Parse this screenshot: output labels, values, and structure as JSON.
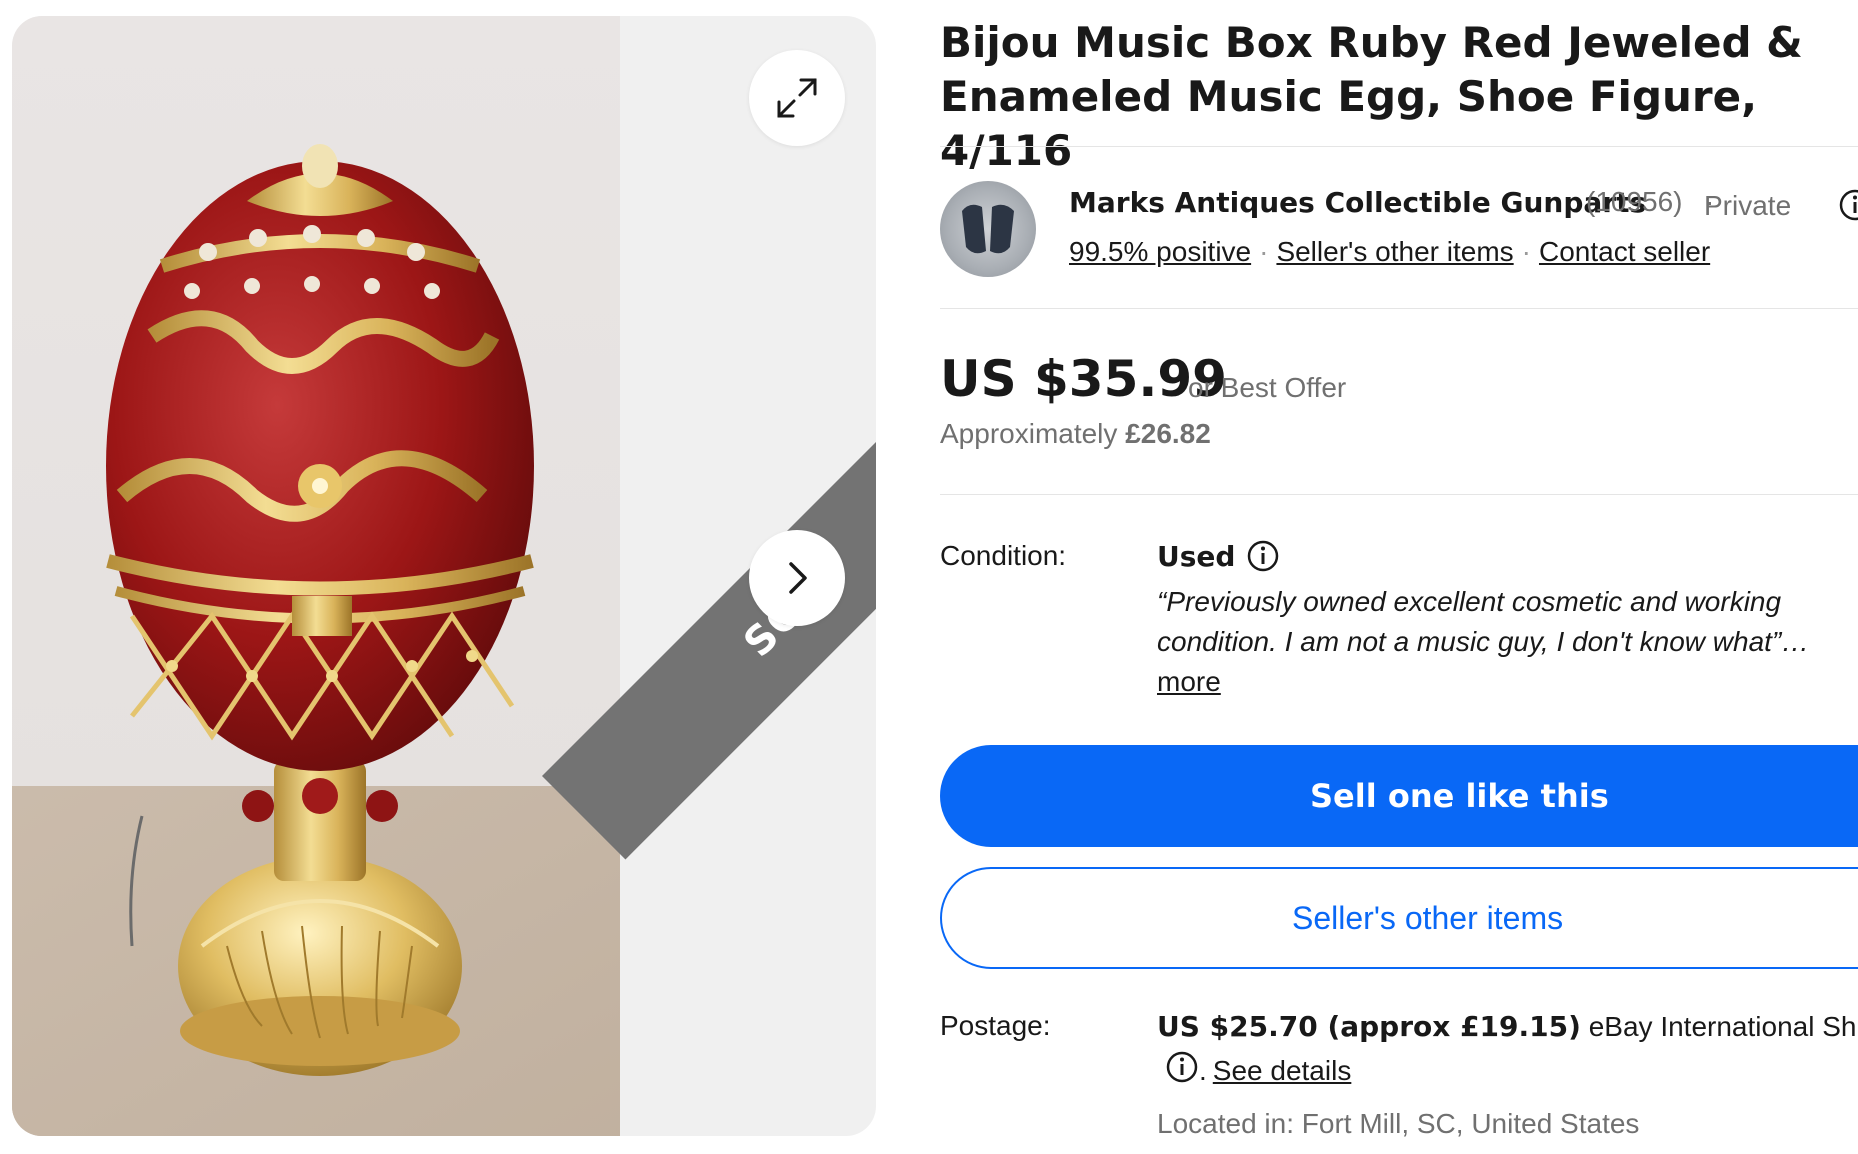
{
  "listing": {
    "title": "Bijou Music Box Ruby Red Jeweled & Enameled Music Egg, Shoe Figure, 4/116",
    "sold_badge": "SOLD"
  },
  "seller": {
    "name": "Marks Antiques Collectible Gunparts",
    "feedback_count": "(10956)",
    "account_type": "Private",
    "positive_link": "99.5% positive",
    "other_items_link": "Seller's other items",
    "contact_link": "Contact seller"
  },
  "price": {
    "amount": "US $35.99",
    "offer_text": "or Best Offer",
    "approx_label": "Approximately",
    "approx_value": "£26.82"
  },
  "condition": {
    "label": "Condition:",
    "value": "Used",
    "quote": "“Previously owned excellent cosmetic and working condition. I am not a music guy, I don't know what”…",
    "more_link": "more"
  },
  "actions": {
    "sell_button": "Sell one like this",
    "other_items_button": "Seller's other items"
  },
  "postage": {
    "label": "Postage:",
    "cost": "US $25.70 (approx £19.15)",
    "service": "eBay International Shipping",
    "details_link": "See details",
    "located": "Located in: Fort Mill, SC, United States"
  },
  "colors": {
    "primary_blue": "#0968f6",
    "sold_ribbon": "#737373",
    "muted_text": "#707070"
  },
  "icons": {
    "expand": "expand-icon",
    "next": "chevron-right-icon",
    "info": "info-icon"
  }
}
